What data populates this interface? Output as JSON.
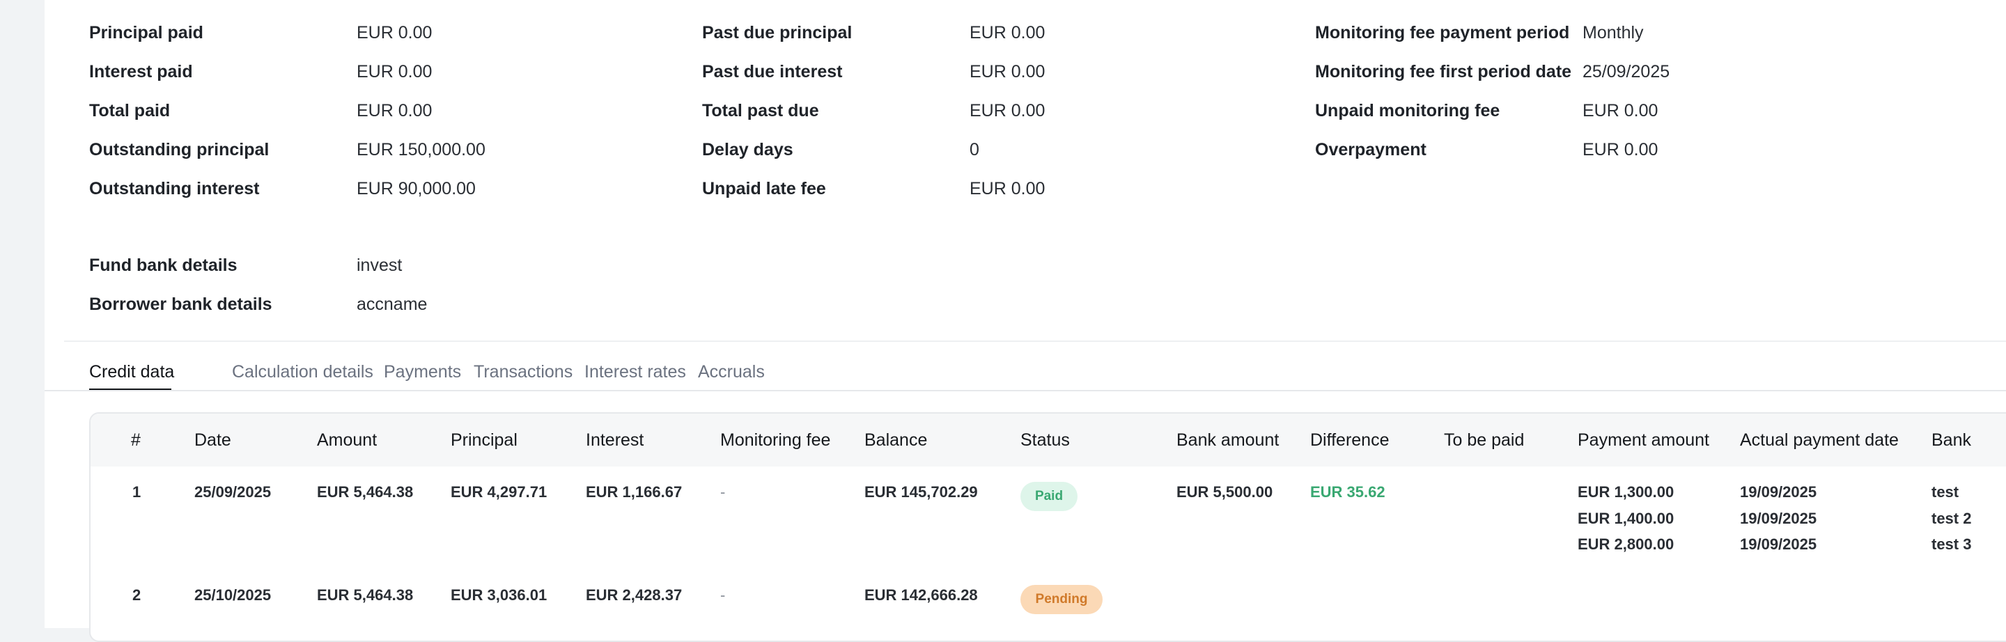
{
  "summary": {
    "col1": [
      {
        "label": "Principal paid",
        "value": "EUR 0.00"
      },
      {
        "label": "Interest paid",
        "value": "EUR 0.00"
      },
      {
        "label": "Total paid",
        "value": "EUR 0.00"
      },
      {
        "label": "Outstanding principal",
        "value": "EUR 150,000.00"
      },
      {
        "label": "Outstanding interest",
        "value": "EUR 90,000.00"
      }
    ],
    "col2": [
      {
        "label": "Past due principal",
        "value": "EUR 0.00"
      },
      {
        "label": "Past due interest",
        "value": "EUR 0.00"
      },
      {
        "label": "Total past due",
        "value": "EUR 0.00"
      },
      {
        "label": "Delay days",
        "value": "0"
      },
      {
        "label": "Unpaid late fee",
        "value": "EUR 0.00"
      }
    ],
    "col3": [
      {
        "label": "Monitoring fee payment period",
        "value": "Monthly"
      },
      {
        "label": "Monitoring fee first period date",
        "value": "25/09/2025"
      },
      {
        "label": "Unpaid monitoring fee",
        "value": "EUR 0.00"
      },
      {
        "label": "Overpayment",
        "value": "EUR 0.00"
      }
    ]
  },
  "bank": [
    {
      "label": "Fund bank details",
      "value": "invest"
    },
    {
      "label": "Borrower bank details",
      "value": "accname"
    }
  ],
  "tabs": [
    "Credit data",
    "Calculation details",
    "Payments",
    "Transactions",
    "Interest rates",
    "Accruals"
  ],
  "table": {
    "headers": [
      "#",
      "Date",
      "Amount",
      "Principal",
      "Interest",
      "Monitoring fee",
      "Balance",
      "Status",
      "Bank amount",
      "Difference",
      "To be paid",
      "Payment amount",
      "Actual payment date",
      "Bank"
    ],
    "rows": [
      {
        "num": "1",
        "date": "25/09/2025",
        "amount": "EUR 5,464.38",
        "principal": "EUR 4,297.71",
        "interest": "EUR 1,166.67",
        "monitoring_fee": "-",
        "balance": "EUR 145,702.29",
        "status": "Paid",
        "bank_amount": "EUR 5,500.00",
        "difference": "EUR 35.62",
        "to_be_paid": "",
        "payments": [
          {
            "amount": "EUR 1,300.00",
            "date": "19/09/2025",
            "bank": "test"
          },
          {
            "amount": "EUR 1,400.00",
            "date": "19/09/2025",
            "bank": "test 2"
          },
          {
            "amount": "EUR 2,800.00",
            "date": "19/09/2025",
            "bank": "test 3"
          }
        ]
      },
      {
        "num": "2",
        "date": "25/10/2025",
        "amount": "EUR 5,464.38",
        "principal": "EUR 3,036.01",
        "interest": "EUR 2,428.37",
        "monitoring_fee": "-",
        "balance": "EUR 142,666.28",
        "status": "Pending",
        "bank_amount": "",
        "difference": "",
        "to_be_paid": "",
        "payments": []
      }
    ]
  },
  "colors": {
    "paid_badge": "#def5ea",
    "pending_badge": "#fbd9b6",
    "positive_text": "#3aa872"
  }
}
